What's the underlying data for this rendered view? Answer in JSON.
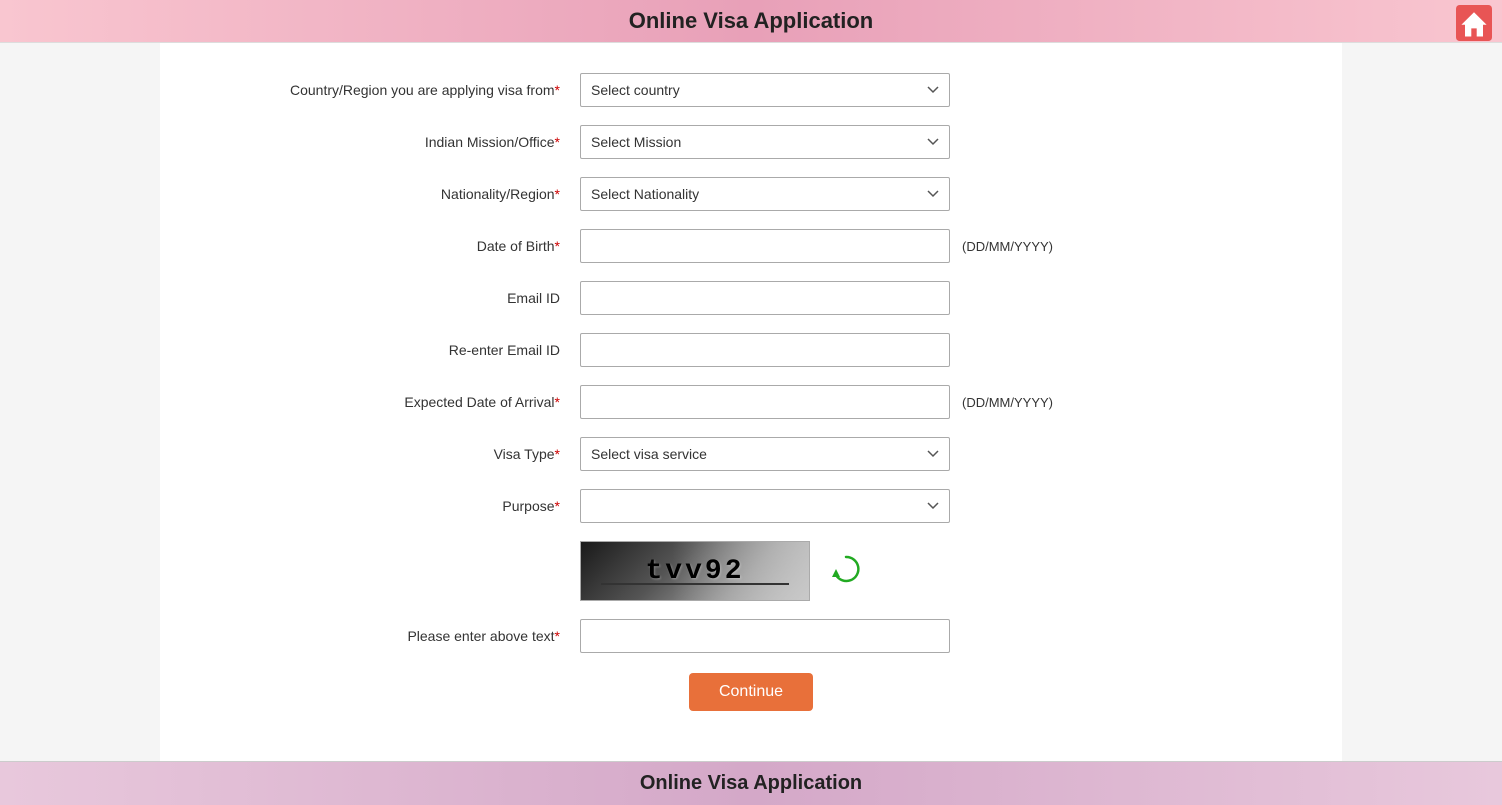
{
  "header": {
    "title": "Online Visa Application",
    "home_icon_label": "home"
  },
  "footer": {
    "title": "Online Visa Application"
  },
  "form": {
    "fields": [
      {
        "id": "country",
        "label": "Country/Region you are applying visa from",
        "required": true,
        "type": "select",
        "placeholder": "Select country",
        "hint": ""
      },
      {
        "id": "mission",
        "label": "Indian Mission/Office",
        "required": true,
        "type": "select",
        "placeholder": "Select Mission",
        "hint": ""
      },
      {
        "id": "nationality",
        "label": "Nationality/Region",
        "required": true,
        "type": "select",
        "placeholder": "Select Nationality",
        "hint": ""
      },
      {
        "id": "dob",
        "label": "Date of Birth",
        "required": true,
        "type": "text",
        "placeholder": "",
        "hint": "(DD/MM/YYYY)"
      },
      {
        "id": "email",
        "label": "Email ID",
        "required": false,
        "type": "text",
        "placeholder": "",
        "hint": ""
      },
      {
        "id": "re_email",
        "label": "Re-enter Email ID",
        "required": false,
        "type": "text",
        "placeholder": "",
        "hint": ""
      },
      {
        "id": "arrival",
        "label": "Expected Date of Arrival",
        "required": true,
        "type": "text",
        "placeholder": "",
        "hint": "(DD/MM/YYYY)"
      },
      {
        "id": "visa_type",
        "label": "Visa Type",
        "required": true,
        "type": "select",
        "placeholder": "Select visa service",
        "hint": ""
      },
      {
        "id": "purpose",
        "label": "Purpose",
        "required": true,
        "type": "select",
        "placeholder": "",
        "hint": ""
      }
    ],
    "captcha_text": "tvv92",
    "captcha_field_label": "Please enter above text",
    "captcha_required": true,
    "continue_button": "Continue"
  },
  "icons": {
    "home": "🏠",
    "refresh": "↻",
    "dropdown_arrow": "▼"
  }
}
